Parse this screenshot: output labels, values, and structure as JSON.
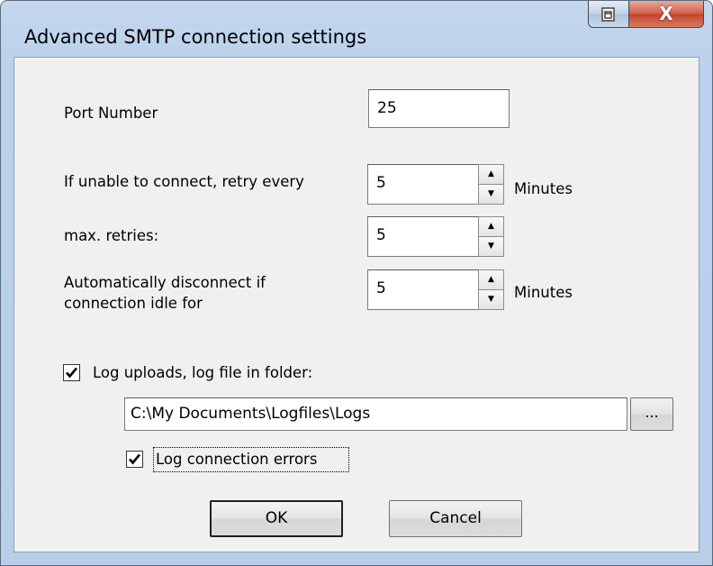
{
  "window": {
    "title": "Advanced SMTP connection settings",
    "close_glyph": "X",
    "restore_icon": "restore-icon"
  },
  "port": {
    "label": "Port Number",
    "value": "25"
  },
  "retry": {
    "label": "If unable to connect, retry every",
    "value": "5",
    "unit": "Minutes"
  },
  "max_retries": {
    "label": "max. retries:",
    "value": "5"
  },
  "idle": {
    "label_line1": "Automatically disconnect if",
    "label_line2": "connection idle for",
    "value": "5",
    "unit": "Minutes"
  },
  "log_uploads": {
    "label": "Log uploads, log file in folder:",
    "checked": true,
    "folder": "C:\\My Documents\\Logfiles\\Logs",
    "browse_label": "..."
  },
  "log_errors": {
    "label": "Log connection errors",
    "checked": true
  },
  "buttons": {
    "ok": "OK",
    "cancel": "Cancel"
  },
  "colors": {
    "frame": "#bcd2ec",
    "client": "#f0f0f0",
    "close_button": "#c2432c"
  }
}
